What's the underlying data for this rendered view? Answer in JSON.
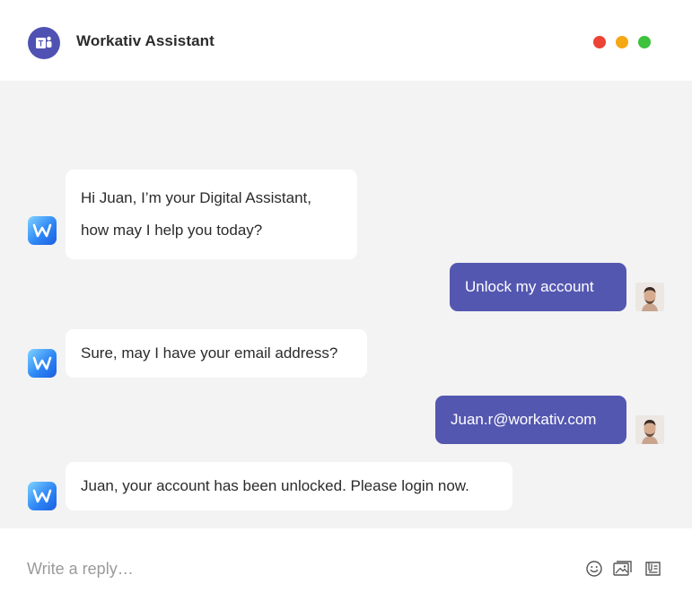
{
  "header": {
    "title": "Workativ Assistant",
    "logo_icon": "microsoft-teams-icon",
    "window_controls": [
      {
        "name": "close",
        "color": "#eb4335"
      },
      {
        "name": "minimize",
        "color": "#f5a716"
      },
      {
        "name": "maximize",
        "color": "#3ec13c"
      }
    ]
  },
  "messages": [
    {
      "sender": "bot",
      "lines": [
        "Hi Juan, I’m your Digital Assistant,",
        "how may I help you today?"
      ]
    },
    {
      "sender": "user",
      "text": "Unlock my account"
    },
    {
      "sender": "bot",
      "text": "Sure, may I have your email address?"
    },
    {
      "sender": "user",
      "text": "Juan.r@workativ.com"
    },
    {
      "sender": "bot",
      "text": "Juan, your account has been unlocked. Please login now."
    }
  ],
  "composer": {
    "placeholder": "Write a reply…",
    "tools": [
      "emoji-icon",
      "image-icon",
      "attachment-icon"
    ]
  },
  "colors": {
    "accent": "#5457b0",
    "chat_background": "#f3f3f3",
    "bot_bubble": "#ffffff",
    "bot_avatar": "#2f87f5"
  }
}
